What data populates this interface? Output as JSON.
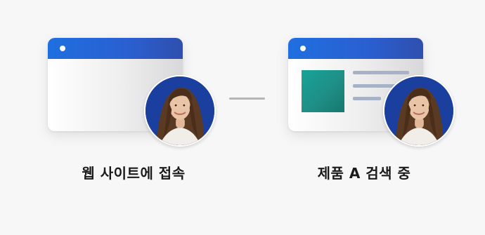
{
  "steps": [
    {
      "label": "웹 사이트에 접속"
    },
    {
      "label": "제품 A 검색 중"
    }
  ],
  "colors": {
    "titlebar": "#2a5fd0",
    "avatar_background": "#1a3f9e",
    "product_image": "#17a398",
    "text_lines": "#a8b2c6",
    "connector": "#b5b5b8"
  },
  "icons": {
    "avatar": "woman-portrait-icon",
    "window_dot": "window-dot-icon"
  }
}
